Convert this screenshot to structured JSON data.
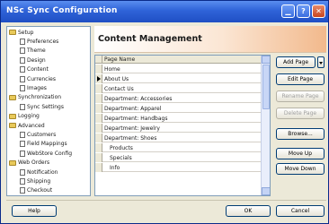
{
  "window": {
    "title": "NSc Sync Configuration"
  },
  "titlebar_buttons": {
    "minimize": "▁",
    "help": "?",
    "close": "✕"
  },
  "tree": [
    {
      "label": "Setup",
      "kind": "folder",
      "indent": 0
    },
    {
      "label": "Preferences",
      "kind": "page",
      "indent": 1
    },
    {
      "label": "Theme",
      "kind": "page",
      "indent": 1
    },
    {
      "label": "Design",
      "kind": "page",
      "indent": 1
    },
    {
      "label": "Content",
      "kind": "page",
      "indent": 1
    },
    {
      "label": "Currencies",
      "kind": "page",
      "indent": 1
    },
    {
      "label": "Images",
      "kind": "page",
      "indent": 1
    },
    {
      "label": "Synchronization",
      "kind": "folder",
      "indent": 0
    },
    {
      "label": "Sync Settings",
      "kind": "page",
      "indent": 1
    },
    {
      "label": "Logging",
      "kind": "folder",
      "indent": 0
    },
    {
      "label": "Advanced",
      "kind": "folder",
      "indent": 0
    },
    {
      "label": "Customers",
      "kind": "page",
      "indent": 1
    },
    {
      "label": "Field Mappings",
      "kind": "page",
      "indent": 1
    },
    {
      "label": "WebStore Config",
      "kind": "page",
      "indent": 1
    },
    {
      "label": "Web Orders",
      "kind": "folder",
      "indent": 0
    },
    {
      "label": "Notification",
      "kind": "page",
      "indent": 1
    },
    {
      "label": "Shipping",
      "kind": "page",
      "indent": 1
    },
    {
      "label": "Checkout",
      "kind": "page",
      "indent": 1
    }
  ],
  "content": {
    "title": "Content Management"
  },
  "grid": {
    "column_header": "Page Name",
    "rows": [
      {
        "label": "Home",
        "indent": 0,
        "current": false
      },
      {
        "label": "About Us",
        "indent": 0,
        "current": true
      },
      {
        "label": "Contact Us",
        "indent": 0,
        "current": false
      },
      {
        "label": "Department: Accessories",
        "indent": 0,
        "current": false
      },
      {
        "label": "Department: Apparel",
        "indent": 0,
        "current": false
      },
      {
        "label": "Department: Handbags",
        "indent": 0,
        "current": false
      },
      {
        "label": "Department: Jewelry",
        "indent": 0,
        "current": false
      },
      {
        "label": "Department: Shoes",
        "indent": 0,
        "current": false
      },
      {
        "label": "Products",
        "indent": 1,
        "current": false
      },
      {
        "label": "Specials",
        "indent": 1,
        "current": false
      },
      {
        "label": "Info",
        "indent": 1,
        "current": false
      }
    ]
  },
  "buttons": {
    "add_page": "Add Page",
    "edit_page": "Edit Page",
    "rename_page": "Rename Page",
    "delete_page": "Delete Page",
    "browse": "Browse...",
    "move_up": "Move Up",
    "move_down": "Move Down",
    "help": "Help",
    "ok": "OK",
    "cancel": "Cancel"
  }
}
